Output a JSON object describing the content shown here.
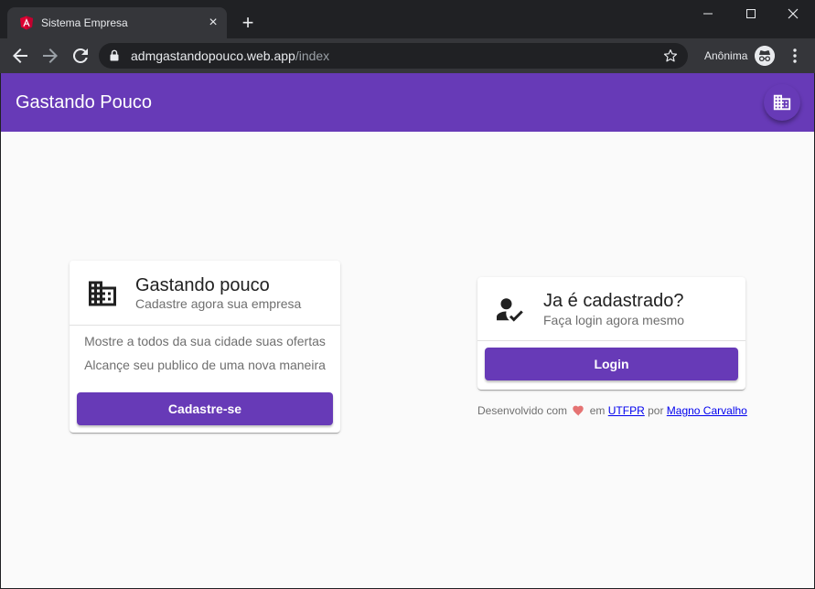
{
  "browser": {
    "tab_title": "Sistema Empresa",
    "tab_close": "×",
    "new_tab": "+",
    "url_host": "admgastandopouco.web.app",
    "url_path": "/index",
    "profile_label": "Anônima"
  },
  "app": {
    "title": "Gastando Pouco",
    "brand_color": "#673ab7"
  },
  "register_card": {
    "title": "Gastando pouco",
    "subtitle": "Cadastre agora sua empresa",
    "lines": [
      "Mostre a todos da sua cidade suas ofertas",
      "Alcançe seu publico de uma nova maneira"
    ],
    "button_label": "Cadastre-se"
  },
  "login_card": {
    "title": "Ja é cadastrado?",
    "subtitle": "Faça login agora mesmo",
    "button_label": "Login"
  },
  "footer": {
    "prefix": "Desenvolvido com",
    "middle": "em",
    "link1": "UTFPR",
    "by": "por",
    "link2": "Magno Carvalho"
  },
  "icons": [
    "angular-icon",
    "back-icon",
    "forward-icon",
    "reload-icon",
    "lock-icon",
    "star-icon",
    "incognito-icon",
    "menu-icon",
    "business-icon",
    "user-check-icon",
    "heart-icon"
  ]
}
